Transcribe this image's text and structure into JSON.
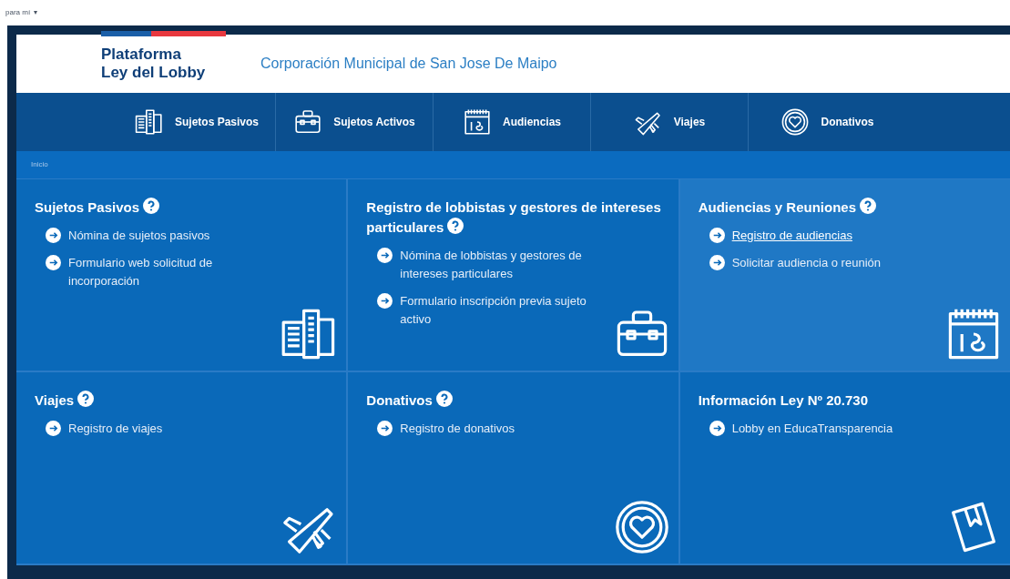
{
  "top_bar": {
    "label": "para mí",
    "caret": "▾"
  },
  "header": {
    "brand_lines": [
      "Plataforma",
      "Ley del Lobby"
    ],
    "organization": "Corporación Municipal de San Jose De Maipo"
  },
  "nav": [
    {
      "label": "Sujetos Pasivos",
      "kind": "buildings"
    },
    {
      "label": "Sujetos Activos",
      "kind": "briefcase"
    },
    {
      "label": "Audiencias",
      "kind": "calendar"
    },
    {
      "label": "Viajes",
      "kind": "plane"
    },
    {
      "label": "Donativos",
      "kind": "heart"
    }
  ],
  "breadcrumb": "Inicio",
  "cards": [
    {
      "title": "Sujetos Pasivos",
      "help": true,
      "highlighted": false,
      "kind": "buildings",
      "links": [
        {
          "text": "Nómina de sujetos pasivos",
          "hovered": false
        },
        {
          "text": "Formulario web solicitud de incorporación",
          "hovered": false
        }
      ]
    },
    {
      "title": "Registro de lobbistas y gestores de intereses particulares",
      "help": true,
      "highlighted": false,
      "kind": "briefcase",
      "links": [
        {
          "text": "Nómina de lobbistas y gestores de intereses particulares",
          "hovered": false
        },
        {
          "text": "Formulario inscripción previa sujeto activo",
          "hovered": false
        }
      ]
    },
    {
      "title": "Audiencias y Reuniones",
      "help": true,
      "highlighted": true,
      "kind": "calendar",
      "links": [
        {
          "text": "Registro de audiencias",
          "hovered": true
        },
        {
          "text": "Solicitar audiencia o reunión",
          "hovered": false
        }
      ]
    },
    {
      "title": "Viajes",
      "help": true,
      "highlighted": false,
      "kind": "plane",
      "links": [
        {
          "text": "Registro de viajes",
          "hovered": false
        }
      ]
    },
    {
      "title": "Donativos",
      "help": true,
      "highlighted": false,
      "kind": "heart",
      "links": [
        {
          "text": "Registro de donativos",
          "hovered": false
        }
      ]
    },
    {
      "title": "Información Ley Nº 20.730",
      "help": false,
      "highlighted": false,
      "kind": "book",
      "links": [
        {
          "text": "Lobby en EducaTransparencia",
          "hovered": false
        }
      ]
    }
  ]
}
